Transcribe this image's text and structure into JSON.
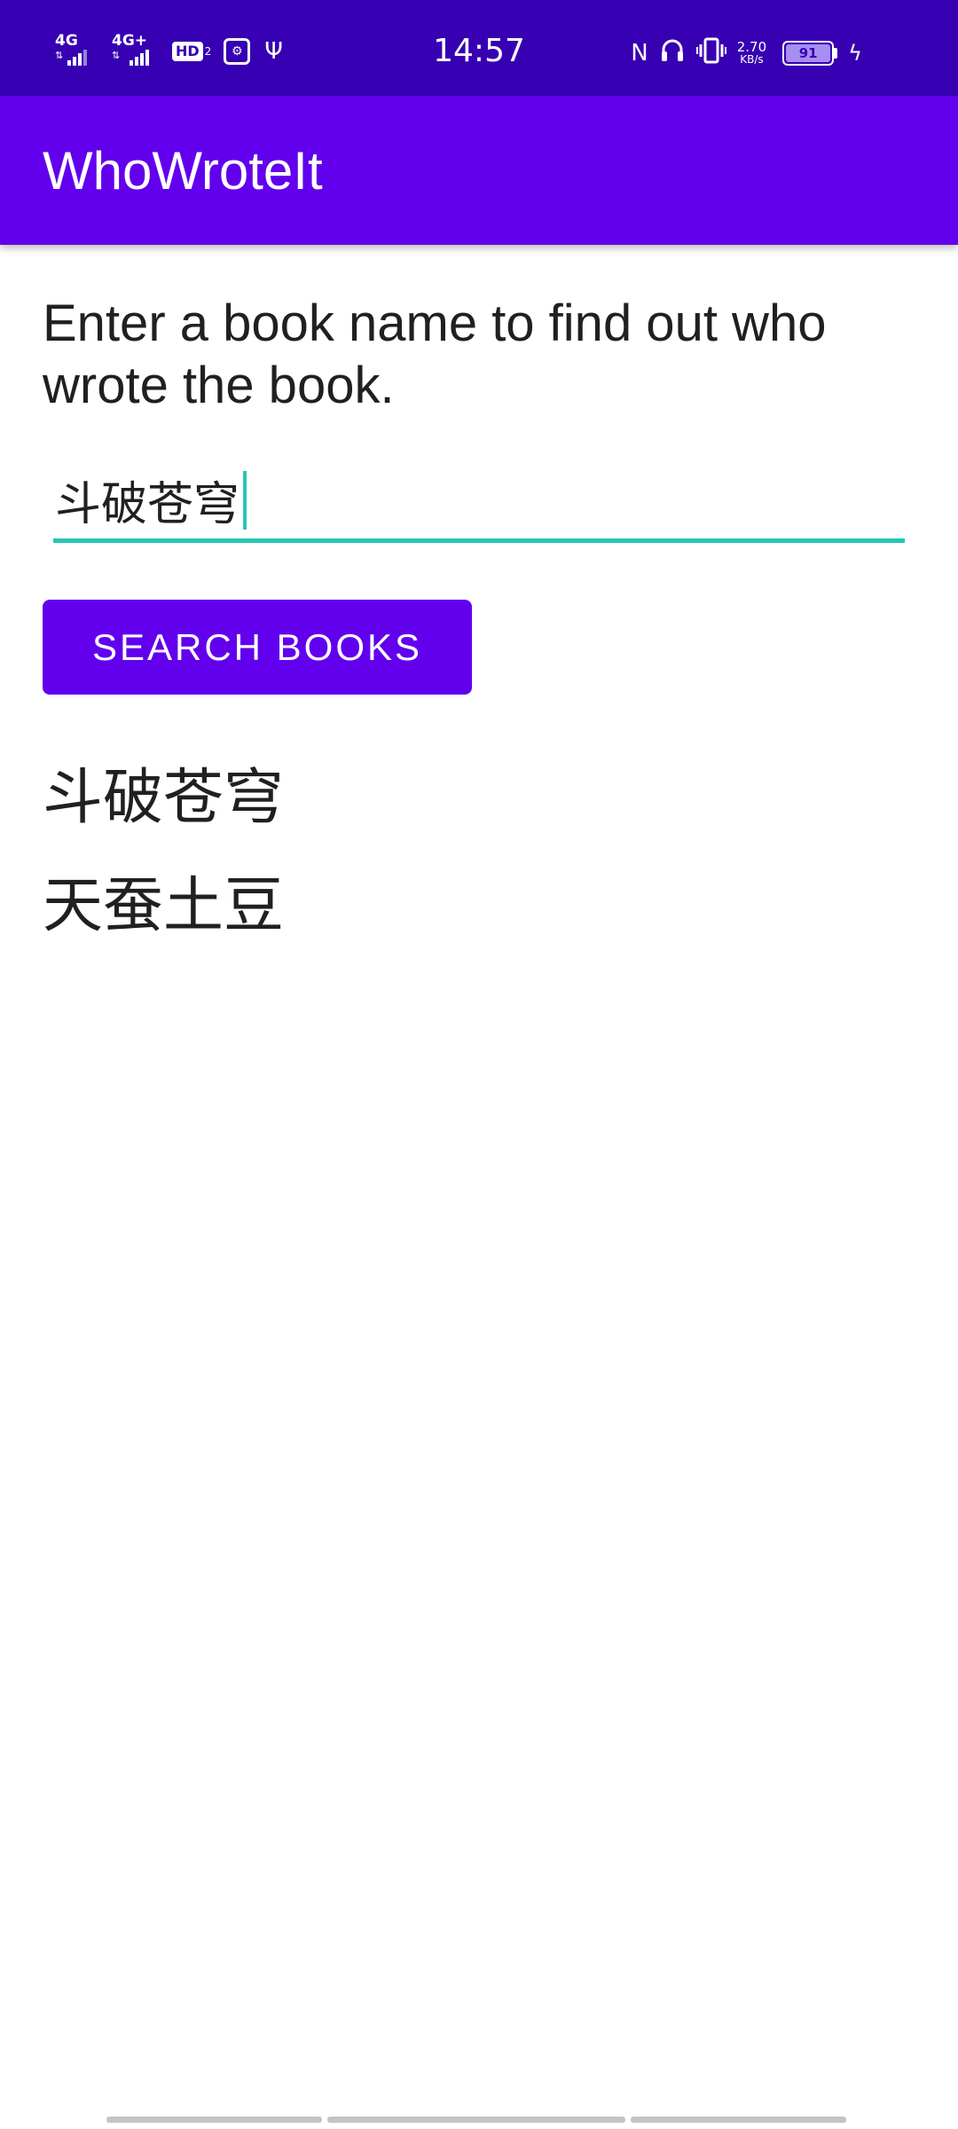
{
  "status_bar": {
    "signal1_label": "4G",
    "signal2_label": "4G+",
    "hd_label": "HD",
    "hd_sub": "2",
    "time": "14:57",
    "net_speed_value": "2.70",
    "net_speed_unit": "KB/s",
    "battery_level": "91",
    "icons": [
      "signal-icon",
      "signal-icon",
      "hd-voice-icon",
      "usb-debug-icon",
      "usb-icon",
      "nfc-icon",
      "headphones-icon",
      "vibrate-icon",
      "battery-icon",
      "charging-icon"
    ]
  },
  "app_bar": {
    "title": "WhoWroteIt"
  },
  "main": {
    "instructions": "Enter a book name to find out who wrote the book.",
    "book_input_value": "斗破苍穹",
    "search_button_label": "SEARCH BOOKS",
    "result_title": "斗破苍穹",
    "result_author": "天蚕土豆"
  },
  "colors": {
    "status_bar": "#3700b3",
    "primary": "#6200ee",
    "accent": "#26c6b4"
  }
}
